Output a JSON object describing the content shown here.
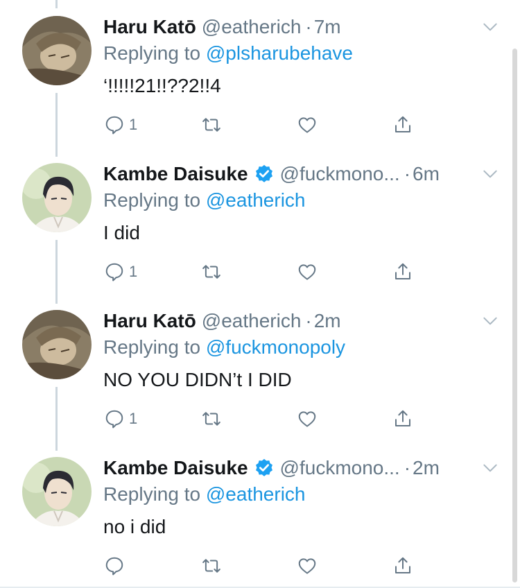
{
  "colors": {
    "text": "#14171a",
    "muted": "#657786",
    "link": "#1b95e0",
    "thread": "#ccd6dd"
  },
  "tweets": [
    {
      "name": "Haru Katō",
      "verified": false,
      "handle": "@eatherich",
      "dot": "·",
      "time": "7m",
      "replying_prefix": "Replying to",
      "replying_to": "@plsharubehave",
      "text": "‘!!!!!21!!??2!!4",
      "reply_count": "1",
      "avatar": "haru-avatar"
    },
    {
      "name": "Kambe Daisuke",
      "verified": true,
      "handle": "@fuckmono...",
      "dot": "·",
      "time": "6m",
      "replying_prefix": "Replying to",
      "replying_to": "@eatherich",
      "text": "I did",
      "reply_count": "1",
      "avatar": "kambe-avatar"
    },
    {
      "name": "Haru Katō",
      "verified": false,
      "handle": "@eatherich",
      "dot": "·",
      "time": "2m",
      "replying_prefix": "Replying to",
      "replying_to": "@fuckmonopoly",
      "text": "NO YOU DIDN’t I DID",
      "reply_count": "1",
      "avatar": "haru-avatar"
    },
    {
      "name": "Kambe Daisuke",
      "verified": true,
      "handle": "@fuckmono...",
      "dot": "·",
      "time": "2m",
      "replying_prefix": "Replying to",
      "replying_to": "@eatherich",
      "text": "no i did",
      "reply_count": "",
      "avatar": "kambe-avatar"
    }
  ]
}
